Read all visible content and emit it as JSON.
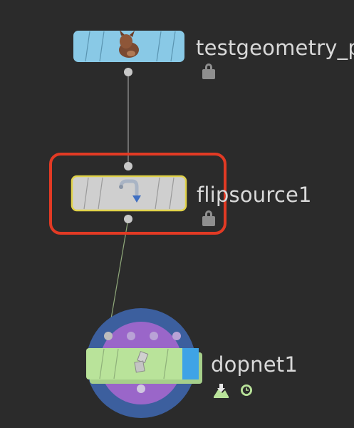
{
  "nodes": [
    {
      "label": "testgeometry_p",
      "icon": "rubber-toy-icon",
      "color": "#89c9e6",
      "flag_icons": [
        "lock-icon"
      ]
    },
    {
      "label": "flipsource1",
      "icon": "faucet-icon",
      "color": "#cfcfcf",
      "selected": true,
      "highlight_color": "#e0d24a",
      "annotation_color": "#e23a24",
      "flag_icons": [
        "lock-icon"
      ]
    },
    {
      "label": "dopnet1",
      "icon": "rigid-pieces-icon",
      "color": "#b9e39a",
      "flag_icons": [
        "display-flag-icon",
        "clock-icon"
      ]
    }
  ],
  "colors": {
    "background": "#2b2b2b",
    "wire": "#9a9a9a",
    "port": "#c8c8c8",
    "dop_outer_ring": "#3c5f9e",
    "dop_inner_ring": "#9a66c9"
  }
}
